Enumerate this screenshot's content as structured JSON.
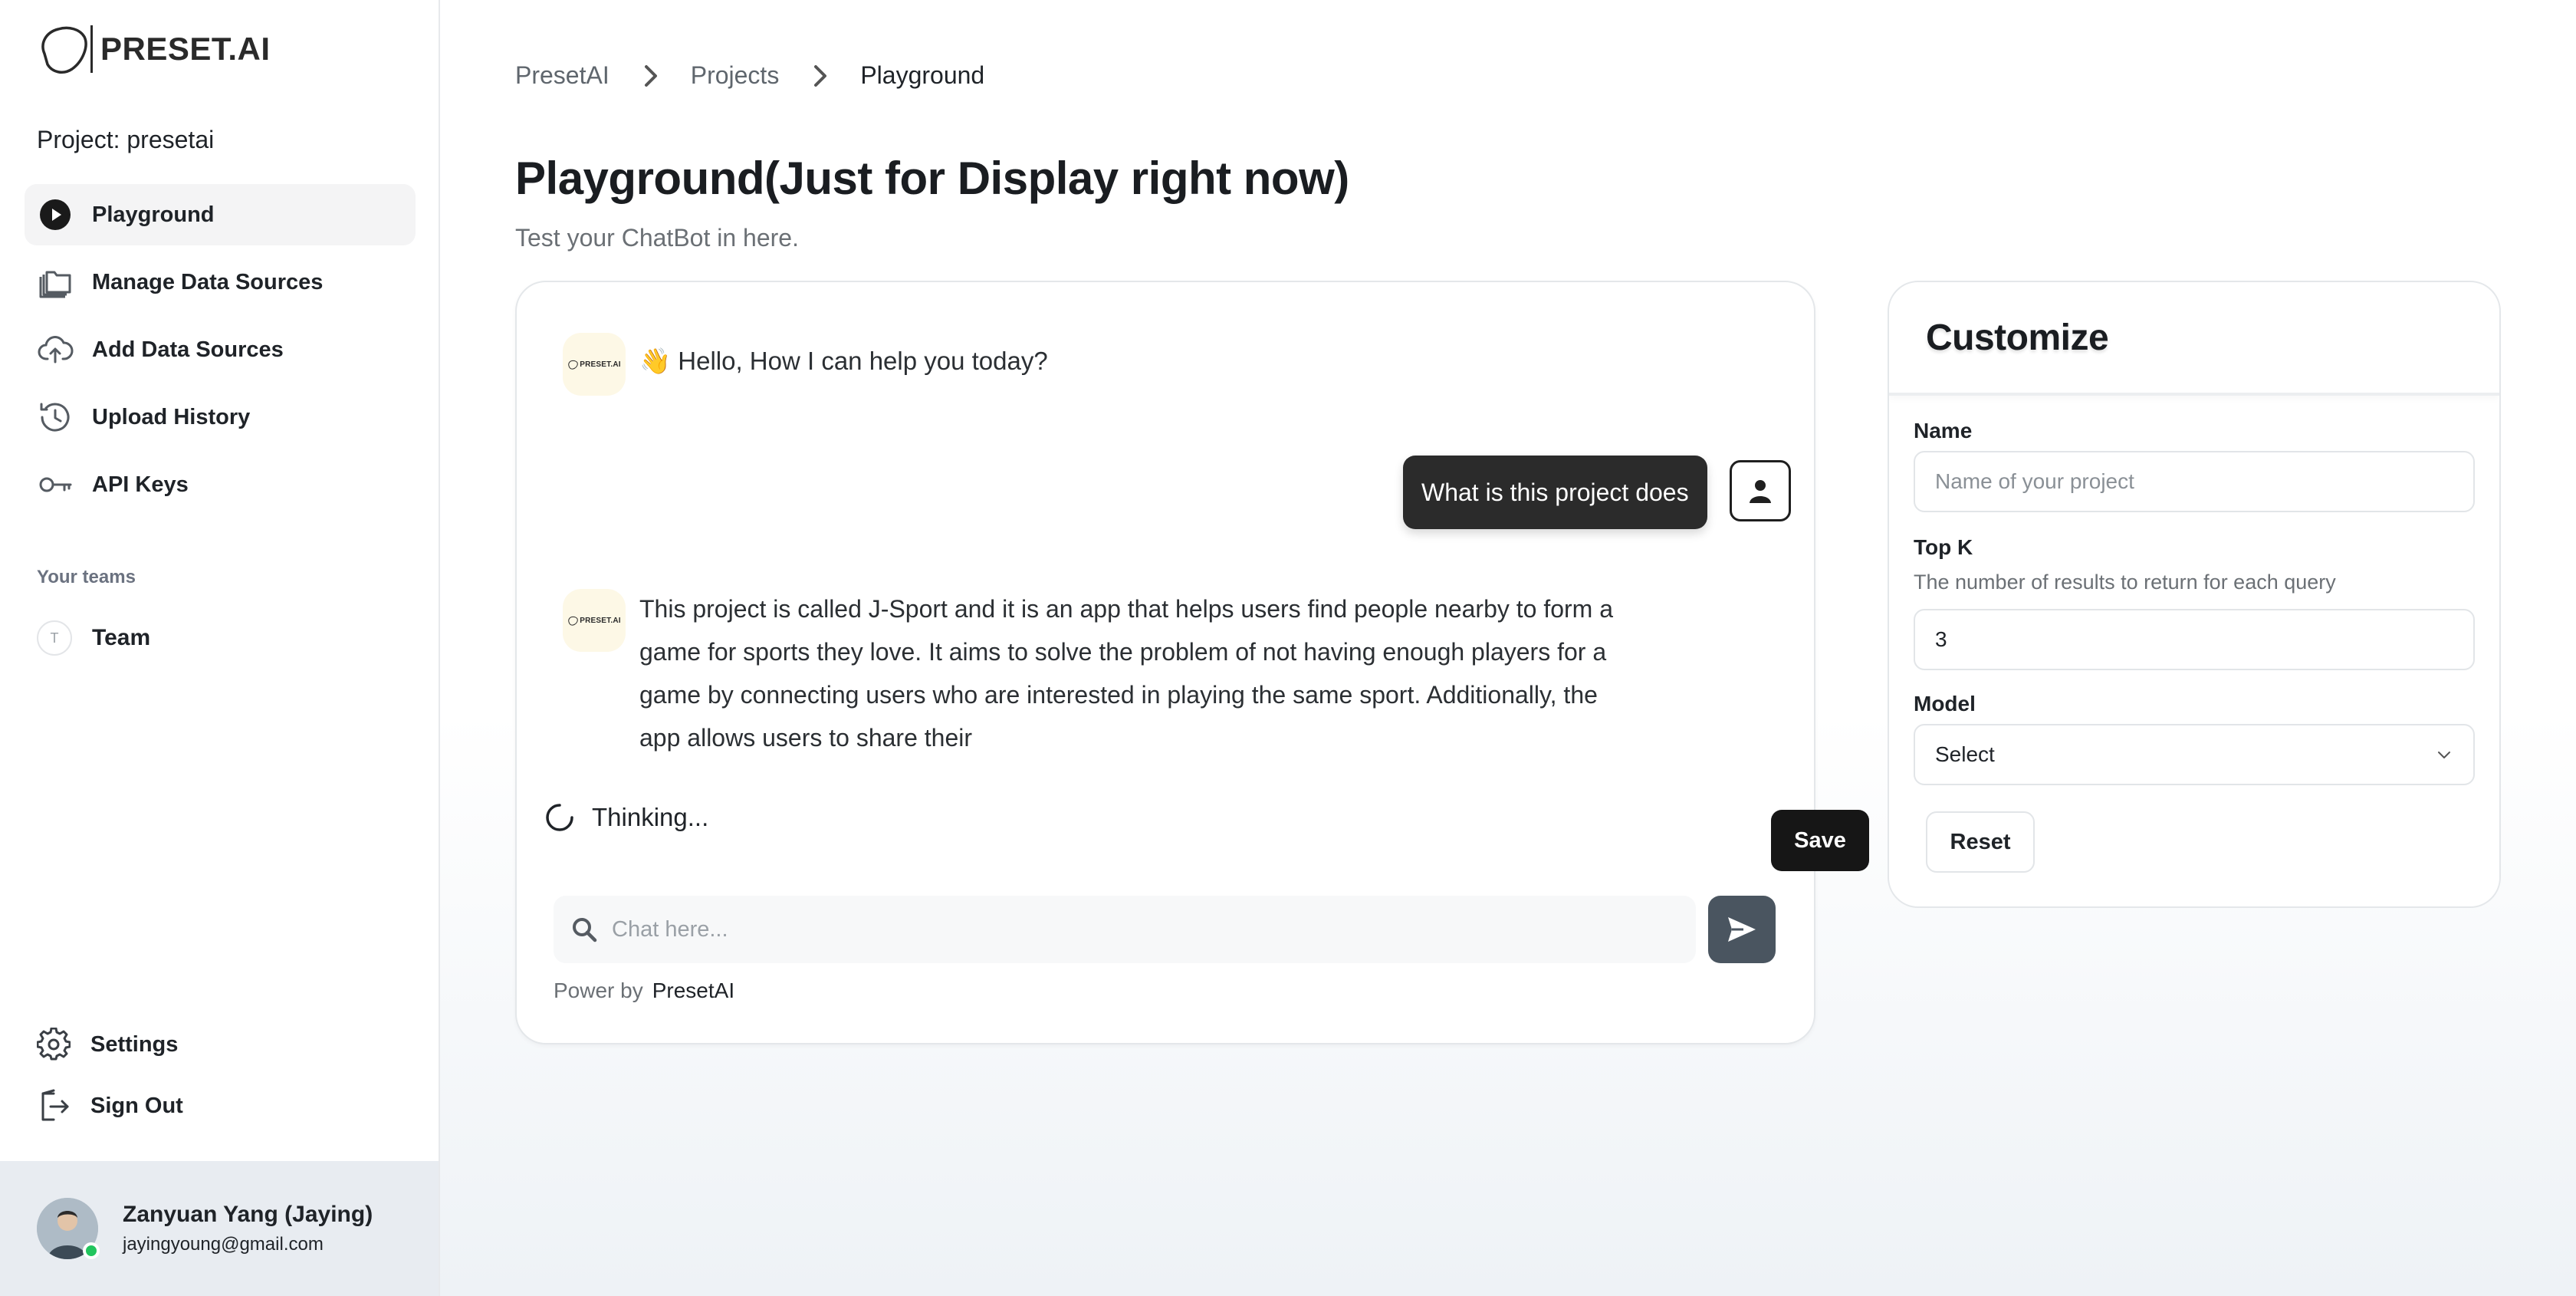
{
  "brand": {
    "logo_text": "PRESET.AI"
  },
  "project": {
    "label": "Project: presetai"
  },
  "sidebar": {
    "items": [
      {
        "label": "Playground",
        "icon": "play-circle-icon",
        "active": true
      },
      {
        "label": "Manage Data Sources",
        "icon": "folders-icon"
      },
      {
        "label": "Add Data Sources",
        "icon": "cloud-upload-icon"
      },
      {
        "label": "Upload History",
        "icon": "history-icon"
      },
      {
        "label": "API Keys",
        "icon": "key-icon"
      }
    ],
    "teams_title": "Your teams",
    "team": {
      "initial": "T",
      "label": "Team"
    },
    "bottom": [
      {
        "label": "Settings",
        "icon": "gear-icon"
      },
      {
        "label": "Sign Out",
        "icon": "sign-out-icon"
      }
    ]
  },
  "user": {
    "name": "Zanyuan Yang (Jaying)",
    "email": "jayingyoung@gmail.com",
    "status_color": "#22c55e"
  },
  "breadcrumb": [
    "PresetAI",
    "Projects",
    "Playground"
  ],
  "page": {
    "title": "Playground(Just for Display right now)",
    "subtitle": "Test your ChatBot in here."
  },
  "chat": {
    "bot_avatar_text": "PRESET.AI",
    "greeting": "👋 Hello, How I can help you today?",
    "user_message": "What is this project does",
    "bot_reply": "This project is called J-Sport and it is an app that helps users find people nearby to form a game for sports they love. It aims to solve the problem of not having enough players for a game by connecting users who are interested in playing the same sport. Additionally, the app allows users to share their",
    "thinking": "Thinking...",
    "input_placeholder": "Chat here...",
    "powered_by_prefix": "Power by",
    "powered_by_brand": "PresetAI"
  },
  "customize": {
    "title": "Customize",
    "name_label": "Name",
    "name_placeholder": "Name of your project",
    "topk_label": "Top K",
    "topk_help": "The number of results to return for each query",
    "topk_value": "3",
    "model_label": "Model",
    "model_value": "Select",
    "reset_label": "Reset",
    "save_label": "Save"
  },
  "colors": {
    "accent": "#161616",
    "send_button": "#4a5560",
    "user_bubble": "#2b2b2b",
    "user_panel_bg": "#e8ecf1"
  }
}
